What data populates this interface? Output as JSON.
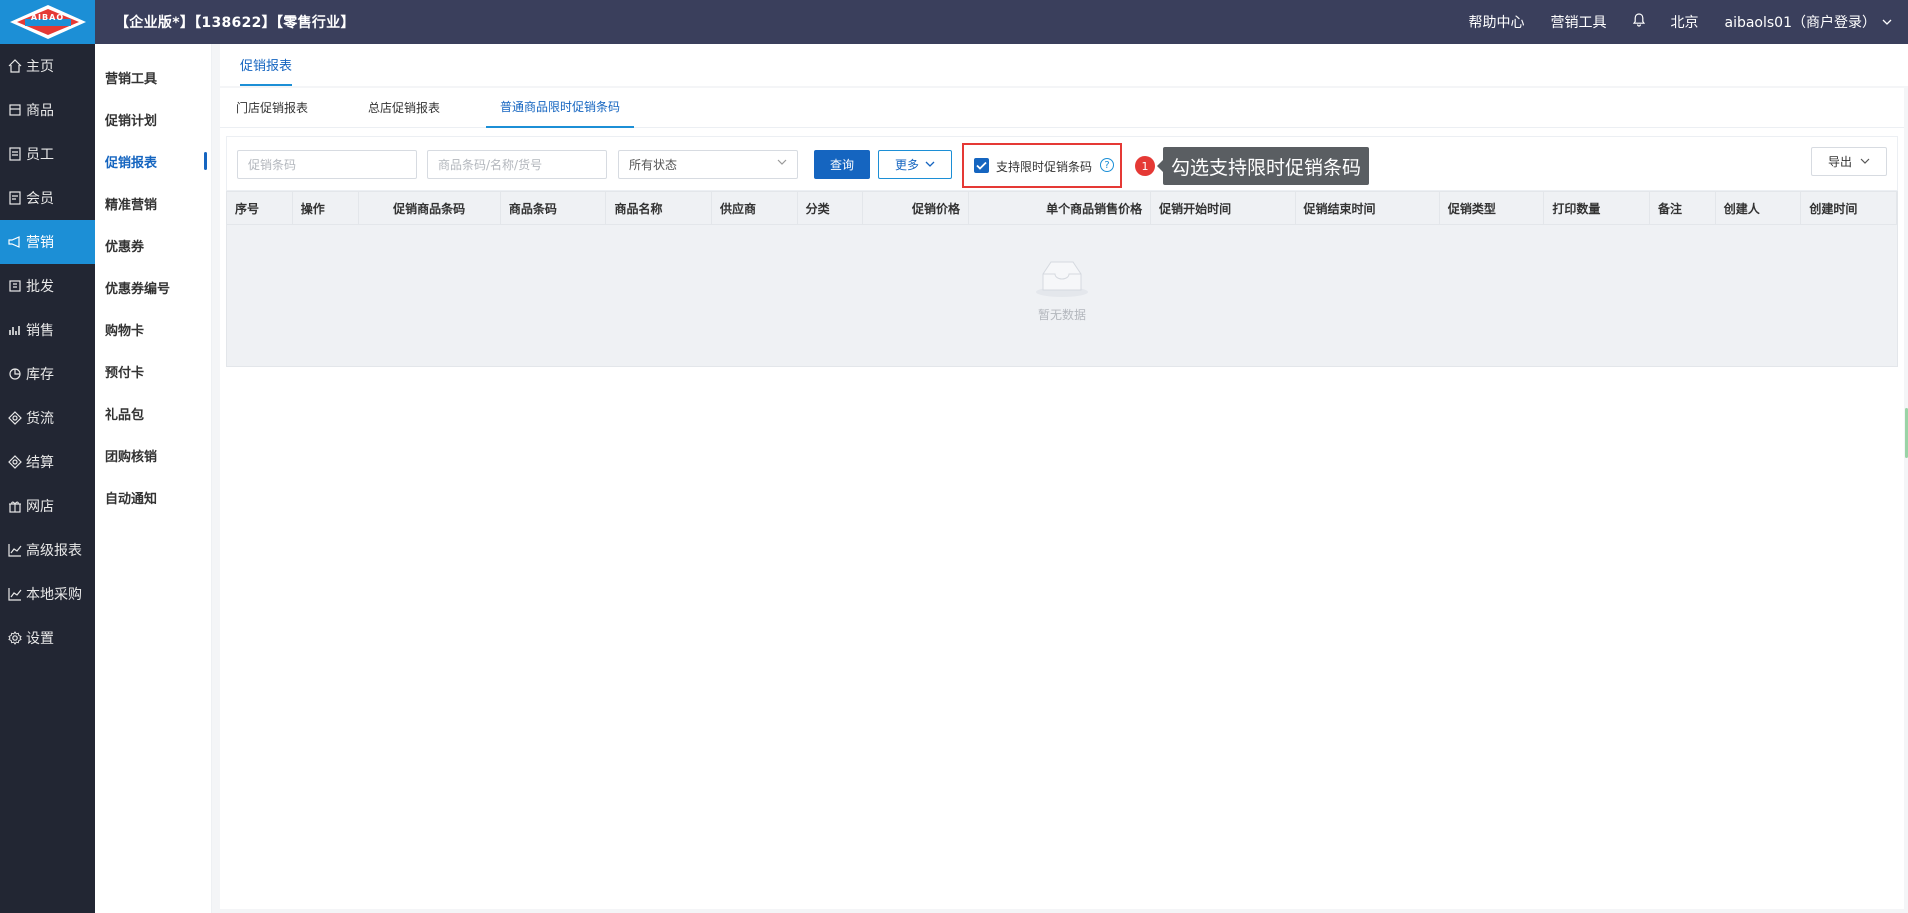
{
  "header": {
    "title": "【企业版*】【138622】【零售行业】",
    "help_center": "帮助中心",
    "marketing_tools": "营销工具",
    "city": "北京",
    "user": "aibaols01（商户登录）"
  },
  "logo": {
    "text": "AIBAO"
  },
  "nav": [
    {
      "label": "主页",
      "icon": "home-icon"
    },
    {
      "label": "商品",
      "icon": "goods-icon"
    },
    {
      "label": "员工",
      "icon": "staff-icon"
    },
    {
      "label": "会员",
      "icon": "member-icon"
    },
    {
      "label": "营销",
      "icon": "megaphone-icon"
    },
    {
      "label": "批发",
      "icon": "wholesale-icon"
    },
    {
      "label": "销售",
      "icon": "sales-chart-icon"
    },
    {
      "label": "库存",
      "icon": "stock-pie-icon"
    },
    {
      "label": "货流",
      "icon": "flow-icon"
    },
    {
      "label": "结算",
      "icon": "settle-icon"
    },
    {
      "label": "网店",
      "icon": "gift-shop-icon"
    },
    {
      "label": "高级报表",
      "icon": "line-chart-icon"
    },
    {
      "label": "本地采购",
      "icon": "line-chart-icon"
    },
    {
      "label": "设置",
      "icon": "gear-icon"
    }
  ],
  "subnav": [
    "营销工具",
    "促销计划",
    "促销报表",
    "精准营销",
    "优惠券",
    "优惠券编号",
    "购物卡",
    "预付卡",
    "礼品包",
    "团购核销",
    "自动通知"
  ],
  "page_tab": "促销报表",
  "subtabs": [
    "门店促销报表",
    "总店促销报表",
    "普通商品限时促销条码"
  ],
  "filters": {
    "promo_code_placeholder": "促销条码",
    "goods_placeholder": "商品条码/名称/货号",
    "status_value": "所有状态",
    "query": "查询",
    "more": "更多",
    "checkbox_label": "支持限时促销条码",
    "help": "?",
    "export": "导出"
  },
  "annotation": {
    "badge": "1",
    "tip": "勾选支持限时促销条码"
  },
  "table": {
    "columns": [
      "序号",
      "操作",
      "促销商品条码",
      "商品条码",
      "商品名称",
      "供应商",
      "分类",
      "促销价格",
      "单个商品销售价格",
      "促销开始时间",
      "促销结束时间",
      "促销类型",
      "打印数量",
      "备注",
      "创建人",
      "创建时间"
    ],
    "empty_text": "暂无数据"
  }
}
